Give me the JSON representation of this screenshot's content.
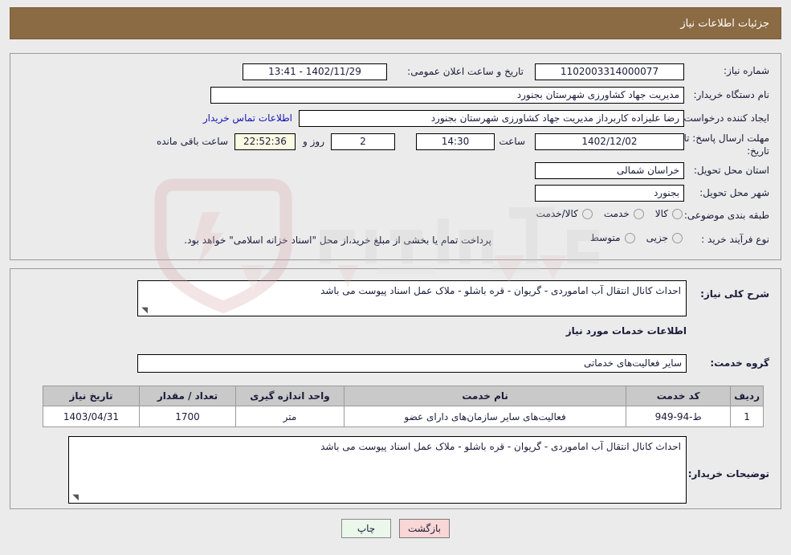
{
  "header": {
    "title": "جزئیات اطلاعات نیاز",
    "bg_color": "#8b6b43"
  },
  "top_panel": {
    "need_number_label": "شماره نیاز:",
    "need_number_value": "1102003314000077",
    "announce_label": "تاریخ و ساعت اعلان عمومی:",
    "announce_value": "1402/11/29 - 13:41",
    "buyer_org_label": "نام دستگاه خریدار:",
    "buyer_org_value": "مدیریت جهاد کشاورزی شهرستان بجنورد",
    "requester_label": "ایجاد کننده درخواست:",
    "requester_value": "رضا  علیزاده کاربرداز مدیریت جهاد کشاورزی شهرستان بجنورد",
    "contact_link": "اطلاعات تماس خریدار",
    "deadline_label_line1": "مهلت ارسال پاسخ: تا",
    "deadline_label_line2": "تاریخ:",
    "deadline_date": "1402/12/02",
    "hour_label": "ساعت",
    "deadline_time": "14:30",
    "days_value": "2",
    "days_label": "روز و",
    "countdown_value": "22:52:36",
    "countdown_label": "ساعت باقی مانده",
    "province_label": "استان محل تحویل:",
    "province_value": "خراسان شمالی",
    "city_label": "شهر محل تحویل:",
    "city_value": "بجنورد",
    "category_label": "طبقه بندی موضوعی:",
    "category_options": [
      {
        "label": "کالا",
        "selected": false
      },
      {
        "label": "خدمت",
        "selected": false
      },
      {
        "label": "کالا/خدمت",
        "selected": false
      }
    ],
    "process_label": "نوع فرآیند خرید :",
    "process_options": [
      {
        "label": "جزیی",
        "selected": false
      },
      {
        "label": "متوسط",
        "selected": false
      }
    ],
    "payment_note": "پرداخت تمام یا بخشی از مبلغ خرید،از محل \"اسناد خزانه اسلامی\" خواهد بود."
  },
  "bottom_panel": {
    "general_desc_label": "شرح کلی نیاز:",
    "general_desc_value": "احداث کانال انتقال آب اماموردی - گریوان - قره باشلو - ملاک عمل اسناد پیوست می باشد",
    "services_heading": "اطلاعات خدمات مورد نیاز",
    "service_group_label": "گروه خدمت:",
    "service_group_value": "سایر فعالیت‌های خدماتی",
    "table": {
      "columns": [
        "ردیف",
        "کد خدمت",
        "نام خدمت",
        "واحد اندازه گیری",
        "تعداد / مقدار",
        "تاریخ نیاز"
      ],
      "rows": [
        {
          "row_no": "1",
          "service_code": "ط-94-949",
          "service_name": "فعالیت‌های سایر سازمان‌های دارای عضو",
          "unit": "متر",
          "quantity": "1700",
          "need_date": "1403/04/31"
        }
      ]
    },
    "buyer_notes_label": "توضیحات خریدار:",
    "buyer_notes_value": "احداث کانال انتقال آب اماموردی - گریوان - قره باشلو - ملاک عمل اسناد پیوست می باشد"
  },
  "footer": {
    "print_label": "چاپ",
    "back_label": "بازگشت",
    "print_color": "#eaf7ea",
    "back_color": "#f9d7d7"
  },
  "watermark": {
    "text": "AriaTender.net",
    "color": "#d8b5b5"
  }
}
